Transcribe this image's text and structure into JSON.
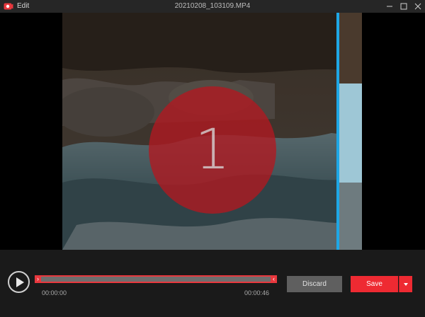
{
  "window": {
    "app_title": "Edit",
    "file_name": "20210208_103109.MP4",
    "icons": [
      "app-record-icon",
      "minimize-icon",
      "maximize-icon",
      "close-icon"
    ]
  },
  "video": {
    "countdown": "1",
    "accent_color": "#1ea7e6",
    "overlay_color": "#b21820"
  },
  "timeline": {
    "start_time": "00:00:00",
    "end_time": "00:00:46",
    "trim_color": "#e8383e",
    "left_handle_glyph": "›",
    "right_handle_glyph": "‹"
  },
  "actions": {
    "discard_label": "Discard",
    "save_label": "Save",
    "save_color": "#ee2a32"
  }
}
